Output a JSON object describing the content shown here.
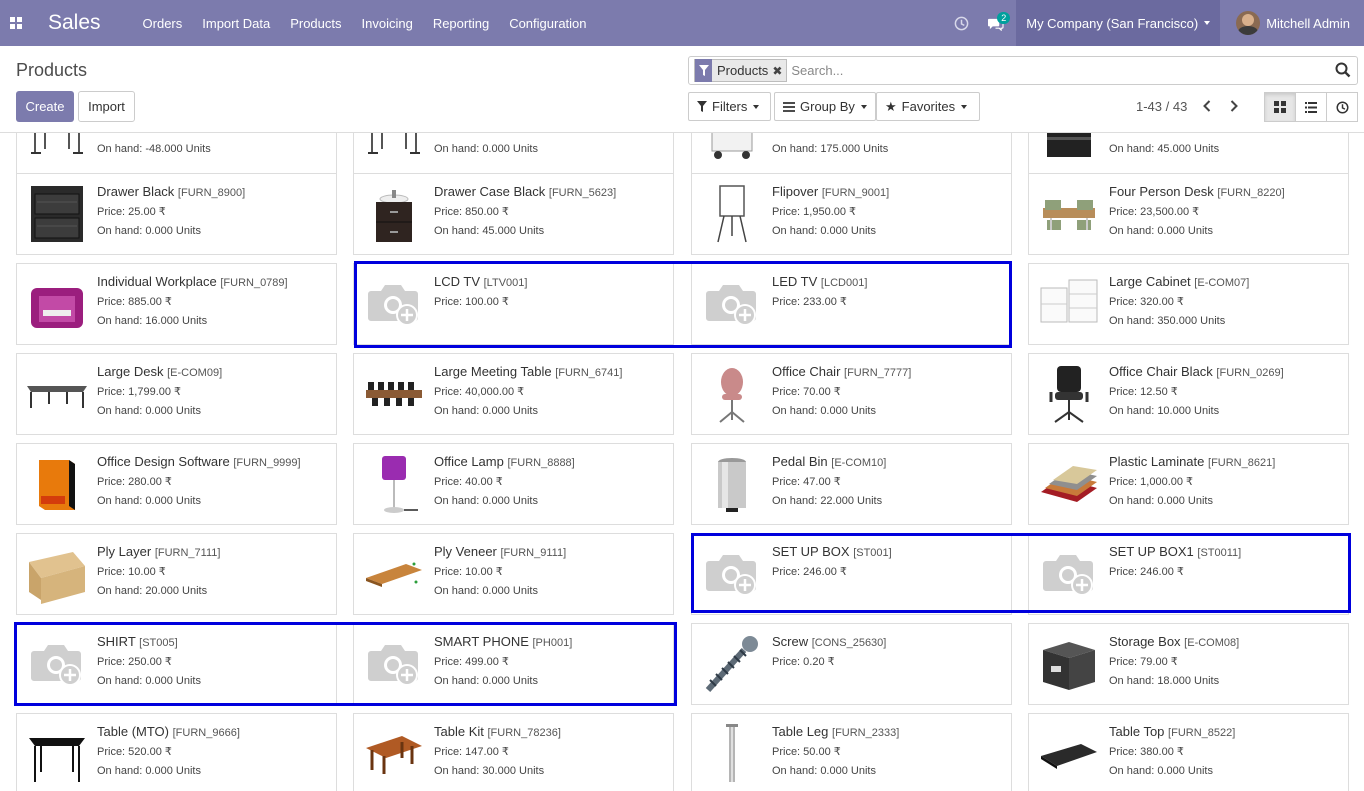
{
  "navbar": {
    "app_title": "Sales",
    "menu": [
      "Orders",
      "Import Data",
      "Products",
      "Invoicing",
      "Reporting",
      "Configuration"
    ],
    "messages_count": "2",
    "company": "My Company (San Francisco)",
    "user": "Mitchell Admin"
  },
  "control_panel": {
    "title": "Products",
    "create_label": "Create",
    "import_label": "Import",
    "facet_label": "Products",
    "search_placeholder": "Search...",
    "filters_label": "Filters",
    "groupby_label": "Group By",
    "favorites_label": "Favorites",
    "pager": "1-43 / 43"
  },
  "products": [
    {
      "name": "",
      "code": "",
      "price": "",
      "onhand": "On hand: -48.000 Units",
      "img": "desk"
    },
    {
      "name": "",
      "code": "",
      "price": "",
      "onhand": "On hand: 0.000 Units",
      "img": "desk"
    },
    {
      "name": "",
      "code": "",
      "price": "",
      "onhand": "On hand: 175.000 Units",
      "img": "cabinet-white"
    },
    {
      "name": "",
      "code": "",
      "price": "",
      "onhand": "On hand: 45.000 Units",
      "img": "cabinet-black"
    },
    {
      "name": "Drawer Black",
      "code": "[FURN_8900]",
      "price": "Price: 25.00 ₹",
      "onhand": "On hand: 0.000 Units",
      "img": "drawer-black"
    },
    {
      "name": "Drawer Case Black",
      "code": "[FURN_5623]",
      "price": "Price: 850.00 ₹",
      "onhand": "On hand: 45.000 Units",
      "img": "drawer-case"
    },
    {
      "name": "Flipover",
      "code": "[FURN_9001]",
      "price": "Price: 1,950.00 ₹",
      "onhand": "On hand: 0.000 Units",
      "img": "flipover"
    },
    {
      "name": "Four Person Desk",
      "code": "[FURN_8220]",
      "price": "Price: 23,500.00 ₹",
      "onhand": "On hand: 0.000 Units",
      "img": "four-desk"
    },
    {
      "name": "Individual Workplace",
      "code": "[FURN_0789]",
      "price": "Price: 885.00 ₹",
      "onhand": "On hand: 16.000 Units",
      "img": "workplace"
    },
    {
      "name": "LCD TV",
      "code": "[LTV001]",
      "price": "Price: 100.00 ₹",
      "onhand": "",
      "img": "placeholder"
    },
    {
      "name": "LED TV",
      "code": "[LCD001]",
      "price": "Price: 233.00 ₹",
      "onhand": "",
      "img": "placeholder"
    },
    {
      "name": "Large Cabinet",
      "code": "[E-COM07]",
      "price": "Price: 320.00 ₹",
      "onhand": "On hand: 350.000 Units",
      "img": "large-cabinet"
    },
    {
      "name": "Large Desk",
      "code": "[E-COM09]",
      "price": "Price: 1,799.00 ₹",
      "onhand": "On hand: 0.000 Units",
      "img": "large-desk"
    },
    {
      "name": "Large Meeting Table",
      "code": "[FURN_6741]",
      "price": "Price: 40,000.00 ₹",
      "onhand": "On hand: 0.000 Units",
      "img": "meeting-table"
    },
    {
      "name": "Office Chair",
      "code": "[FURN_7777]",
      "price": "Price: 70.00 ₹",
      "onhand": "On hand: 0.000 Units",
      "img": "chair-pink"
    },
    {
      "name": "Office Chair Black",
      "code": "[FURN_0269]",
      "price": "Price: 12.50 ₹",
      "onhand": "On hand: 10.000 Units",
      "img": "chair-black"
    },
    {
      "name": "Office Design Software",
      "code": "[FURN_9999]",
      "price": "Price: 280.00 ₹",
      "onhand": "On hand: 0.000 Units",
      "img": "software"
    },
    {
      "name": "Office Lamp",
      "code": "[FURN_8888]",
      "price": "Price: 40.00 ₹",
      "onhand": "On hand: 0.000 Units",
      "img": "lamp"
    },
    {
      "name": "Pedal Bin",
      "code": "[E-COM10]",
      "price": "Price: 47.00 ₹",
      "onhand": "On hand: 22.000 Units",
      "img": "bin"
    },
    {
      "name": "Plastic Laminate",
      "code": "[FURN_8621]",
      "price": "Price: 1,000.00 ₹",
      "onhand": "On hand: 0.000 Units",
      "img": "laminate"
    },
    {
      "name": "Ply Layer",
      "code": "[FURN_7111]",
      "price": "Price: 10.00 ₹",
      "onhand": "On hand: 20.000 Units",
      "img": "ply-layer"
    },
    {
      "name": "Ply Veneer",
      "code": "[FURN_9111]",
      "price": "Price: 10.00 ₹",
      "onhand": "On hand: 0.000 Units",
      "img": "veneer"
    },
    {
      "name": "SET UP BOX",
      "code": "[ST001]",
      "price": "Price: 246.00 ₹",
      "onhand": "",
      "img": "placeholder"
    },
    {
      "name": "SET UP BOX1",
      "code": "[ST0011]",
      "price": "Price: 246.00 ₹",
      "onhand": "",
      "img": "placeholder"
    },
    {
      "name": "SHIRT",
      "code": "[ST005]",
      "price": "Price: 250.00 ₹",
      "onhand": "On hand: 0.000 Units",
      "img": "placeholder"
    },
    {
      "name": "SMART PHONE",
      "code": "[PH001]",
      "price": "Price: 499.00 ₹",
      "onhand": "On hand: 0.000 Units",
      "img": "placeholder"
    },
    {
      "name": "Screw",
      "code": "[CONS_25630]",
      "price": "Price: 0.20 ₹",
      "onhand": "",
      "img": "screw"
    },
    {
      "name": "Storage Box",
      "code": "[E-COM08]",
      "price": "Price: 79.00 ₹",
      "onhand": "On hand: 18.000 Units",
      "img": "storage-box"
    },
    {
      "name": "Table (MTO)",
      "code": "[FURN_9666]",
      "price": "Price: 520.00 ₹",
      "onhand": "On hand: 0.000 Units",
      "img": "table-mto"
    },
    {
      "name": "Table Kit",
      "code": "[FURN_78236]",
      "price": "Price: 147.00 ₹",
      "onhand": "On hand: 30.000 Units",
      "img": "table-kit"
    },
    {
      "name": "Table Leg",
      "code": "[FURN_2333]",
      "price": "Price: 50.00 ₹",
      "onhand": "On hand: 0.000 Units",
      "img": "table-leg"
    },
    {
      "name": "Table Top",
      "code": "[FURN_8522]",
      "price": "Price: 380.00 ₹",
      "onhand": "On hand: 0.000 Units",
      "img": "table-top"
    }
  ],
  "colors": {
    "brand": "#7c7bad",
    "highlight": "#0000dd",
    "badge": "#00a09d"
  }
}
